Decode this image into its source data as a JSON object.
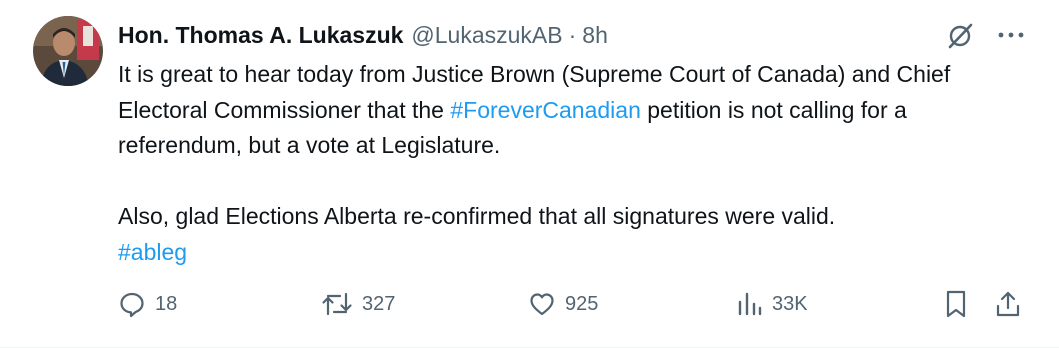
{
  "author": {
    "name": "Hon. Thomas A. Lukaszuk",
    "handle": "@LukaszukAB",
    "separator": "·",
    "time": "8h"
  },
  "tweet": {
    "p1_before": "It is great to hear today from Justice Brown (Supreme Court of Canada) and Chief Electoral Commissioner that the ",
    "p1_hashtag": "#ForeverCanadian",
    "p1_after": " petition is not calling for a referendum, but a vote at Legislature.",
    "p2": "Also, glad Elections Alberta re-confirmed that all signatures were valid.",
    "p2_hashtag": "#ableg"
  },
  "actions": {
    "replies": "18",
    "reposts": "327",
    "likes": "925",
    "views": "33K"
  },
  "icons": {
    "top": [
      "grok-icon",
      "more-icon"
    ],
    "actions": [
      "reply-icon",
      "repost-icon",
      "like-icon",
      "views-icon",
      "bookmark-icon",
      "share-icon"
    ]
  },
  "colors": {
    "text": "#0f1419",
    "secondary": "#536471",
    "link": "#1d9bf0",
    "divider": "#eff3f4"
  }
}
